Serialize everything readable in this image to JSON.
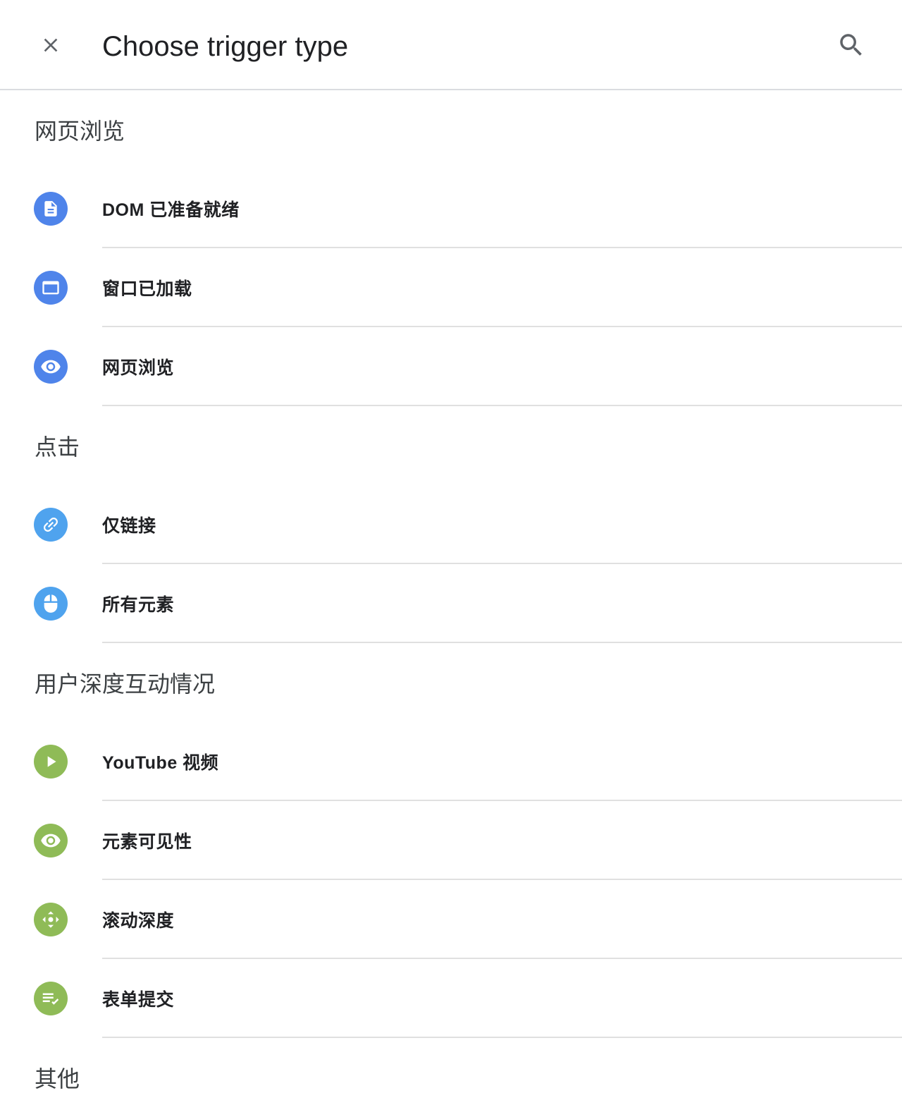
{
  "header": {
    "title": "Choose trigger type"
  },
  "sections": [
    {
      "title": "网页浏览",
      "items": [
        {
          "label": "DOM 已准备就绪",
          "icon": "document-icon",
          "color": "#4f84ea"
        },
        {
          "label": "窗口已加载",
          "icon": "window-icon",
          "color": "#4f84ea"
        },
        {
          "label": "网页浏览",
          "icon": "eye-icon",
          "color": "#4f84ea"
        }
      ]
    },
    {
      "title": "点击",
      "items": [
        {
          "label": "仅链接",
          "icon": "link-icon",
          "color": "#4fa3ee"
        },
        {
          "label": "所有元素",
          "icon": "mouse-icon",
          "color": "#4fa3ee"
        }
      ]
    },
    {
      "title": "用户深度互动情况",
      "items": [
        {
          "label": "YouTube 视频",
          "icon": "play-icon",
          "color": "#8fbb57"
        },
        {
          "label": "元素可见性",
          "icon": "eye-icon",
          "color": "#8fbb57"
        },
        {
          "label": "滚动深度",
          "icon": "scroll-arrows-icon",
          "color": "#8fbb57"
        },
        {
          "label": "表单提交",
          "icon": "form-submit-icon",
          "color": "#8fbb57"
        }
      ]
    },
    {
      "title": "其他",
      "items": []
    }
  ]
}
